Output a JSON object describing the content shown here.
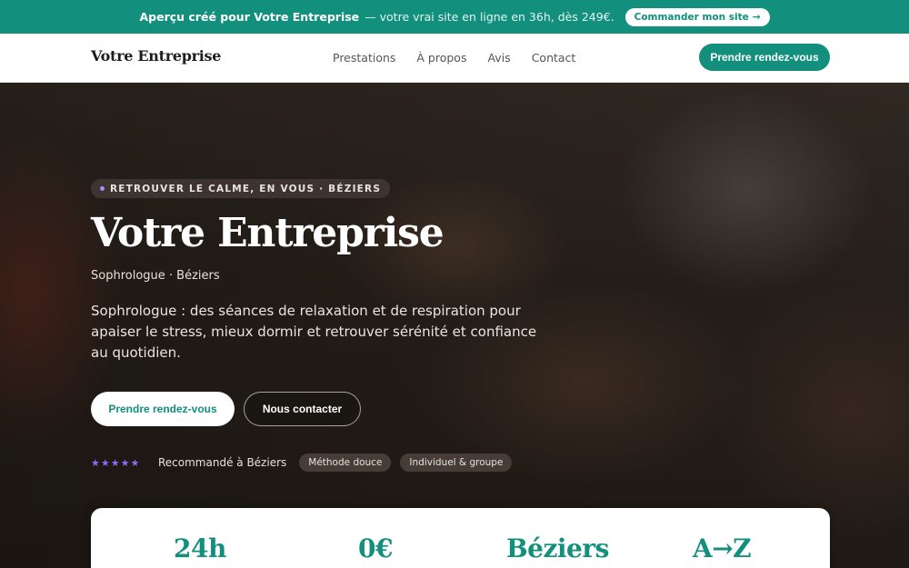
{
  "promo": {
    "text_bold": "Aperçu créé pour Votre Entreprise",
    "text_rest": "— votre vrai site en ligne en 36h, dès 249€.",
    "cta_label": "Commander mon site",
    "cta_arrow": "→"
  },
  "nav": {
    "brand": "Votre Entreprise",
    "links": [
      "Prestations",
      "À propos",
      "Avis",
      "Contact"
    ],
    "cta_label": "Prendre rendez-vous"
  },
  "hero": {
    "eyebrow": "RETROUVER LE CALME, EN VOUS · BÉZIERS",
    "title": "Votre Entreprise",
    "subtitle": "Sophrologue · Béziers",
    "description": "Sophrologue : des séances de relaxation et de respiration pour apaiser le stress, mieux dormir et retrouver sérénité et confiance au quotidien.",
    "primary_button": "Prendre rendez-vous",
    "secondary_button": "Nous contacter",
    "stars": "★★★★★",
    "trust_text": "Recommandé à Béziers",
    "pills": [
      "Méthode douce",
      "Individuel & groupe"
    ]
  },
  "stats": [
    "24h",
    "0€",
    "Béziers",
    "A→Z"
  ],
  "colors": {
    "accent": "#138f7e",
    "star": "#8b6cf6",
    "banner": "#138f7e"
  }
}
